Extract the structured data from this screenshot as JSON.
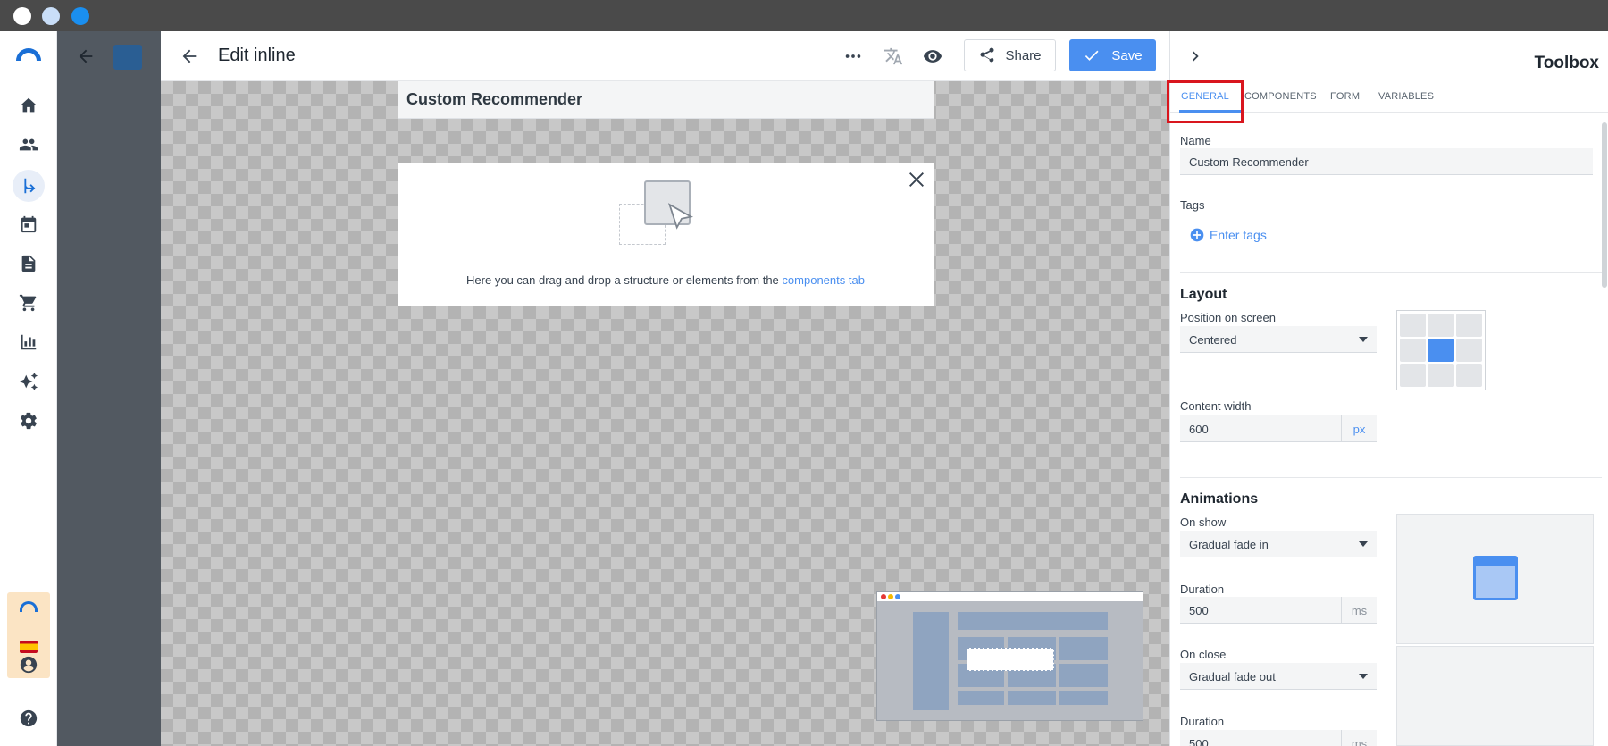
{
  "header": {
    "title": "Edit inline",
    "share_label": "Share",
    "save_label": "Save"
  },
  "canvas": {
    "block_title": "Custom Recommender",
    "drop_text": "Here you can drag and drop a structure or elements from the",
    "drop_link": "components tab"
  },
  "toolbox": {
    "title": "Toolbox",
    "tabs": [
      "GENERAL",
      "COMPONENTS",
      "FORM",
      "VARIABLES"
    ],
    "name_label": "Name",
    "name_value": "Custom Recommender",
    "tags_label": "Tags",
    "tags_action": "Enter tags",
    "layout_title": "Layout",
    "position_label": "Position on screen",
    "position_value": "Centered",
    "content_width_label": "Content width",
    "content_width_value": "600",
    "content_width_unit": "px",
    "animations_title": "Animations",
    "on_show_label": "On show",
    "on_show_value": "Gradual fade in",
    "duration_label": "Duration",
    "duration_value": "500",
    "duration_unit": "ms",
    "on_close_label": "On close",
    "on_close_value": "Gradual fade out",
    "duration2_label": "Duration",
    "duration2_value": "500",
    "duration2_unit": "ms"
  },
  "colors": {
    "accent": "#4a8ff0",
    "highlight": "#d9161e"
  }
}
